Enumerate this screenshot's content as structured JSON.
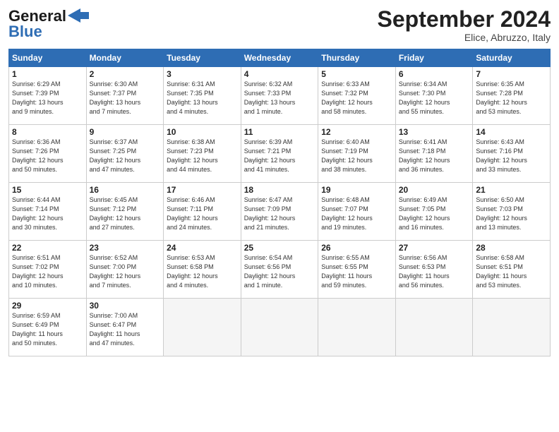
{
  "header": {
    "logo_general": "General",
    "logo_blue": "Blue",
    "month_title": "September 2024",
    "subtitle": "Elice, Abruzzo, Italy"
  },
  "days_of_week": [
    "Sunday",
    "Monday",
    "Tuesday",
    "Wednesday",
    "Thursday",
    "Friday",
    "Saturday"
  ],
  "weeks": [
    [
      {
        "day": "1",
        "info": "Sunrise: 6:29 AM\nSunset: 7:39 PM\nDaylight: 13 hours\nand 9 minutes."
      },
      {
        "day": "2",
        "info": "Sunrise: 6:30 AM\nSunset: 7:37 PM\nDaylight: 13 hours\nand 7 minutes."
      },
      {
        "day": "3",
        "info": "Sunrise: 6:31 AM\nSunset: 7:35 PM\nDaylight: 13 hours\nand 4 minutes."
      },
      {
        "day": "4",
        "info": "Sunrise: 6:32 AM\nSunset: 7:33 PM\nDaylight: 13 hours\nand 1 minute."
      },
      {
        "day": "5",
        "info": "Sunrise: 6:33 AM\nSunset: 7:32 PM\nDaylight: 12 hours\nand 58 minutes."
      },
      {
        "day": "6",
        "info": "Sunrise: 6:34 AM\nSunset: 7:30 PM\nDaylight: 12 hours\nand 55 minutes."
      },
      {
        "day": "7",
        "info": "Sunrise: 6:35 AM\nSunset: 7:28 PM\nDaylight: 12 hours\nand 53 minutes."
      }
    ],
    [
      {
        "day": "8",
        "info": "Sunrise: 6:36 AM\nSunset: 7:26 PM\nDaylight: 12 hours\nand 50 minutes."
      },
      {
        "day": "9",
        "info": "Sunrise: 6:37 AM\nSunset: 7:25 PM\nDaylight: 12 hours\nand 47 minutes."
      },
      {
        "day": "10",
        "info": "Sunrise: 6:38 AM\nSunset: 7:23 PM\nDaylight: 12 hours\nand 44 minutes."
      },
      {
        "day": "11",
        "info": "Sunrise: 6:39 AM\nSunset: 7:21 PM\nDaylight: 12 hours\nand 41 minutes."
      },
      {
        "day": "12",
        "info": "Sunrise: 6:40 AM\nSunset: 7:19 PM\nDaylight: 12 hours\nand 38 minutes."
      },
      {
        "day": "13",
        "info": "Sunrise: 6:41 AM\nSunset: 7:18 PM\nDaylight: 12 hours\nand 36 minutes."
      },
      {
        "day": "14",
        "info": "Sunrise: 6:43 AM\nSunset: 7:16 PM\nDaylight: 12 hours\nand 33 minutes."
      }
    ],
    [
      {
        "day": "15",
        "info": "Sunrise: 6:44 AM\nSunset: 7:14 PM\nDaylight: 12 hours\nand 30 minutes."
      },
      {
        "day": "16",
        "info": "Sunrise: 6:45 AM\nSunset: 7:12 PM\nDaylight: 12 hours\nand 27 minutes."
      },
      {
        "day": "17",
        "info": "Sunrise: 6:46 AM\nSunset: 7:11 PM\nDaylight: 12 hours\nand 24 minutes."
      },
      {
        "day": "18",
        "info": "Sunrise: 6:47 AM\nSunset: 7:09 PM\nDaylight: 12 hours\nand 21 minutes."
      },
      {
        "day": "19",
        "info": "Sunrise: 6:48 AM\nSunset: 7:07 PM\nDaylight: 12 hours\nand 19 minutes."
      },
      {
        "day": "20",
        "info": "Sunrise: 6:49 AM\nSunset: 7:05 PM\nDaylight: 12 hours\nand 16 minutes."
      },
      {
        "day": "21",
        "info": "Sunrise: 6:50 AM\nSunset: 7:03 PM\nDaylight: 12 hours\nand 13 minutes."
      }
    ],
    [
      {
        "day": "22",
        "info": "Sunrise: 6:51 AM\nSunset: 7:02 PM\nDaylight: 12 hours\nand 10 minutes."
      },
      {
        "day": "23",
        "info": "Sunrise: 6:52 AM\nSunset: 7:00 PM\nDaylight: 12 hours\nand 7 minutes."
      },
      {
        "day": "24",
        "info": "Sunrise: 6:53 AM\nSunset: 6:58 PM\nDaylight: 12 hours\nand 4 minutes."
      },
      {
        "day": "25",
        "info": "Sunrise: 6:54 AM\nSunset: 6:56 PM\nDaylight: 12 hours\nand 1 minute."
      },
      {
        "day": "26",
        "info": "Sunrise: 6:55 AM\nSunset: 6:55 PM\nDaylight: 11 hours\nand 59 minutes."
      },
      {
        "day": "27",
        "info": "Sunrise: 6:56 AM\nSunset: 6:53 PM\nDaylight: 11 hours\nand 56 minutes."
      },
      {
        "day": "28",
        "info": "Sunrise: 6:58 AM\nSunset: 6:51 PM\nDaylight: 11 hours\nand 53 minutes."
      }
    ],
    [
      {
        "day": "29",
        "info": "Sunrise: 6:59 AM\nSunset: 6:49 PM\nDaylight: 11 hours\nand 50 minutes."
      },
      {
        "day": "30",
        "info": "Sunrise: 7:00 AM\nSunset: 6:47 PM\nDaylight: 11 hours\nand 47 minutes."
      },
      {
        "day": "",
        "info": ""
      },
      {
        "day": "",
        "info": ""
      },
      {
        "day": "",
        "info": ""
      },
      {
        "day": "",
        "info": ""
      },
      {
        "day": "",
        "info": ""
      }
    ]
  ]
}
